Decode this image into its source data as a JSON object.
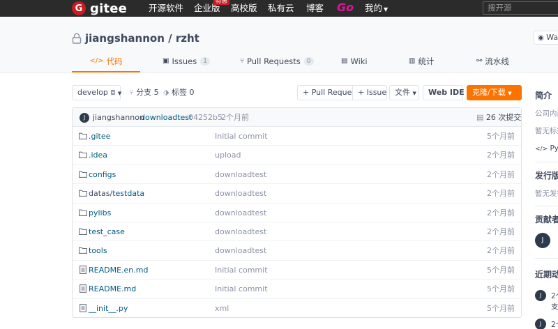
{
  "nav": {
    "logo_text": "gitee",
    "items": [
      "开源软件",
      "企业版",
      "高校版",
      "私有云",
      "博客"
    ],
    "badge": "特惠",
    "go": "Go",
    "mine": "我的",
    "search_placeholder": "搜开源"
  },
  "repo": {
    "owner": "jiangshannon",
    "separator": " / ",
    "name": "rzht",
    "watch": "Watch"
  },
  "tabs": [
    {
      "label": "代码"
    },
    {
      "label": "Issues",
      "count": "1"
    },
    {
      "label": "Pull Requests",
      "count": "0"
    },
    {
      "label": "Wiki"
    },
    {
      "label": "统计"
    },
    {
      "label": "流水线"
    }
  ],
  "toolbar": {
    "branch": "develop",
    "branches_label": "分支",
    "branches_count": "5",
    "tags_label": "标签",
    "tags_count": "0",
    "pull_request": "+ Pull Request",
    "issue": "+ Issue",
    "file_menu": "文件",
    "web_ide": "Web IDE",
    "clone": "克隆/下载"
  },
  "commit": {
    "avatar_letter": "J",
    "author": "jiangshannon",
    "message": "downloadtest",
    "hash": "04252b5",
    "time": "2个月前",
    "commit_count": "26 次提交"
  },
  "files": [
    {
      "type": "folder",
      "prefix": "",
      "name": ".gitee",
      "message": "Initial commit",
      "time": "5个月前"
    },
    {
      "type": "folder",
      "prefix": "",
      "name": ".idea",
      "message": "upload",
      "time": "2个月前"
    },
    {
      "type": "folder",
      "prefix": "",
      "name": "configs",
      "message": "downloadtest",
      "time": "2个月前"
    },
    {
      "type": "folder",
      "prefix": "datas/",
      "name": "testdata",
      "message": "downloadtest",
      "time": "2个月前"
    },
    {
      "type": "folder",
      "prefix": "",
      "name": "pylibs",
      "message": "downloadtest",
      "time": "2个月前"
    },
    {
      "type": "folder",
      "prefix": "",
      "name": "test_case",
      "message": "downloadtest",
      "time": "2个月前"
    },
    {
      "type": "folder",
      "prefix": "",
      "name": "tools",
      "message": "downloadtest",
      "time": "2个月前"
    },
    {
      "type": "file",
      "prefix": "",
      "name": "README.en.md",
      "message": "Initial commit",
      "time": "5个月前"
    },
    {
      "type": "file",
      "prefix": "",
      "name": "README.md",
      "message": "Initial commit",
      "time": "5个月前"
    },
    {
      "type": "file",
      "prefix": "",
      "name": "__init__.py",
      "message": "xml",
      "time": "5个月前"
    }
  ],
  "sidebar": {
    "intro_title": "简介",
    "intro_text": "公司内部",
    "no_tags": "暂无标签",
    "language": "Python",
    "release_title": "发行版",
    "no_release": "暂无发行",
    "contributors_title": "贡献者",
    "contributor_letter": "J",
    "activity_title": "近期动态",
    "activity": [
      {
        "letter": "J",
        "line1": "2个",
        "line2": "支"
      },
      {
        "letter": "J",
        "line1": "2个",
        "line2": ""
      }
    ]
  },
  "colors": {
    "accent": "#fe7300",
    "link": "#005980",
    "nav_bg": "#2b2b2b",
    "brand_red": "#c71d23"
  }
}
